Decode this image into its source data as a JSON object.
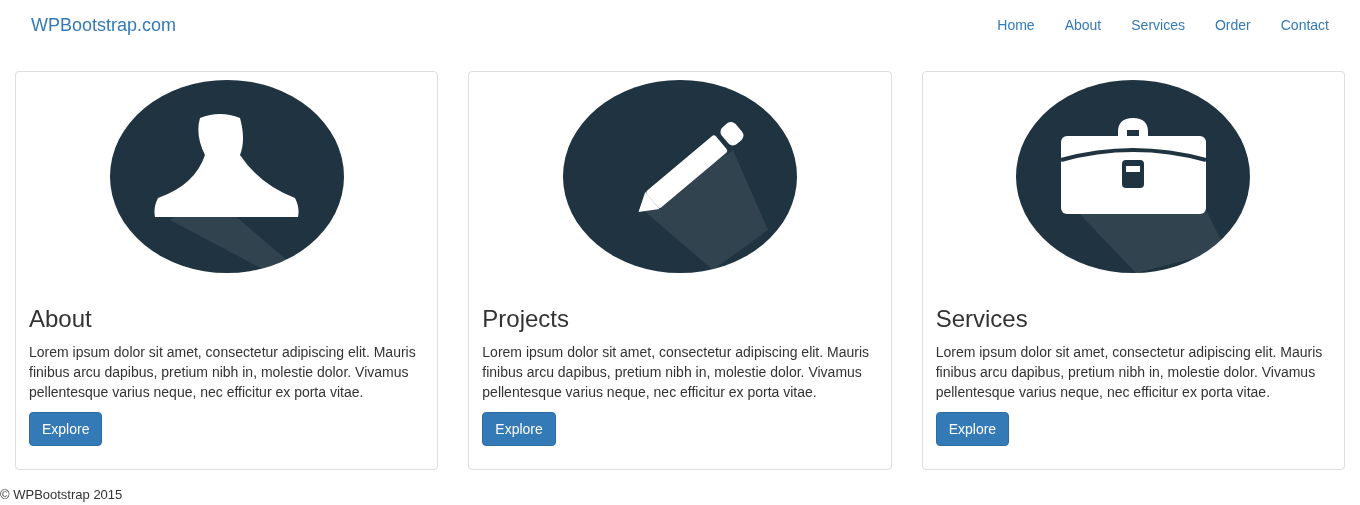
{
  "navbar": {
    "brand": "WPBootstrap.com",
    "links": [
      "Home",
      "About",
      "Services",
      "Order",
      "Contact"
    ]
  },
  "cards": [
    {
      "title": "About",
      "text": "Lorem ipsum dolor sit amet, consectetur adipiscing elit. Mauris finibus arcu dapibus, pretium nibh in, molestie dolor. Vivamus pellentesque varius neque, nec efficitur ex porta vitae.",
      "button": "Explore"
    },
    {
      "title": "Projects",
      "text": "Lorem ipsum dolor sit amet, consectetur adipiscing elit. Mauris finibus arcu dapibus, pretium nibh in, molestie dolor. Vivamus pellentesque varius neque, nec efficitur ex porta vitae.",
      "button": "Explore"
    },
    {
      "title": "Services",
      "text": "Lorem ipsum dolor sit amet, consectetur adipiscing elit. Mauris finibus arcu dapibus, pretium nibh in, molestie dolor. Vivamus pellentesque varius neque, nec efficitur ex porta vitae.",
      "button": "Explore"
    }
  ],
  "footer": "© WPBootstrap 2015"
}
